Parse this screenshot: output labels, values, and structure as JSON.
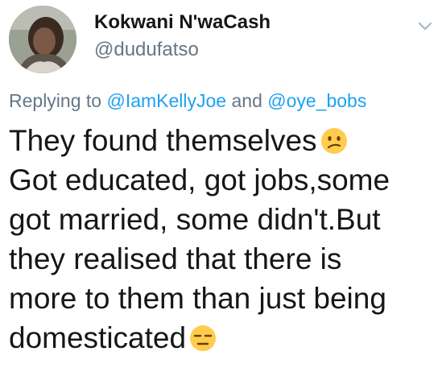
{
  "tweet": {
    "author": {
      "display_name": "Kokwani N'waCash",
      "handle": "@dudufatso",
      "avatar_icon": "user-avatar"
    },
    "menu_icon": "chevron-down-icon",
    "reply_to": {
      "prefix": "Replying to",
      "mentions": [
        "@IamKellyJoe",
        "@oye_bobs"
      ],
      "conjunction": "and"
    },
    "body_lines": [
      "They found themselves",
      "Got educated, got jobs,some",
      "got married, some didn't.But",
      "they realised that there is",
      "more to them than just being",
      "domesticated"
    ],
    "emojis": {
      "line_1": "confused-face-emoji",
      "line_6": "expressionless-face-emoji"
    },
    "colors": {
      "text": "#14171a",
      "secondary": "#657786",
      "link": "#1da1f2",
      "emoji": "#ffcc4d"
    }
  }
}
